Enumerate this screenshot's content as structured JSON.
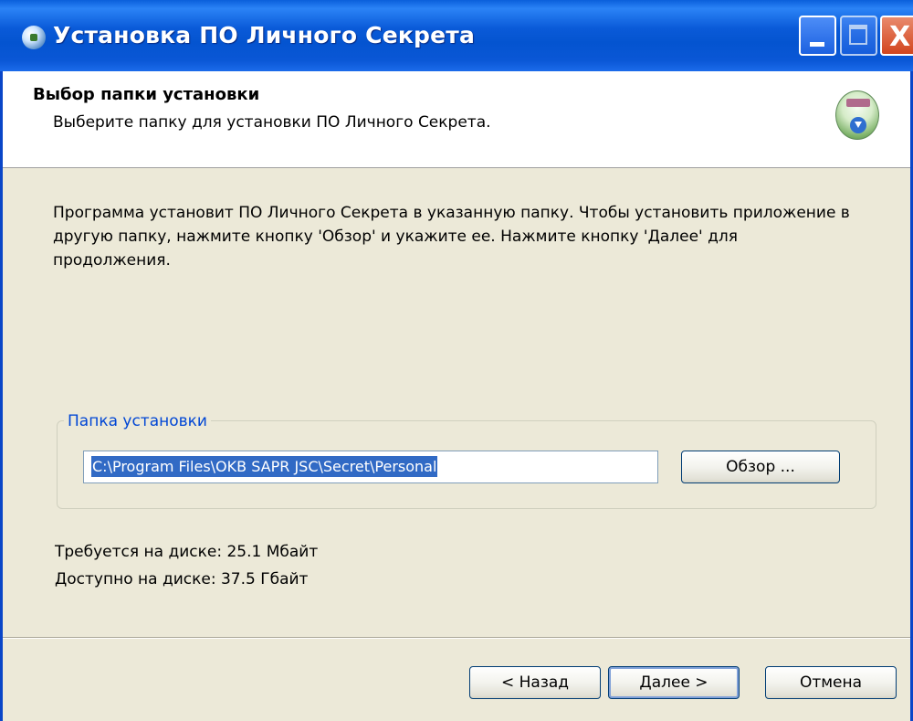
{
  "window": {
    "title": "Установка ПО Личного Секрета",
    "minimize_glyph": "_",
    "close_glyph": "X"
  },
  "header": {
    "title": "Выбор папки установки",
    "subtitle": "Выберите папку для установки ПО Личного Секрета.",
    "logo_icon": "installer-disk-icon"
  },
  "body": {
    "description": "Программа установит ПО Личного Секрета в указанную папку. Чтобы установить приложение в другую папку, нажмите кнопку 'Обзор' и укажите ее. Нажмите кнопку 'Далее' для продолжения.",
    "group_label": "Папка установки",
    "install_path": "C:\\Program Files\\OKB SAPR JSC\\Secret\\Personal",
    "browse_label": "Обзор ...",
    "space_required": "Требуется на диске: 25.1 Мбайт",
    "space_available": "Доступно на диске: 37.5 Гбайт"
  },
  "footer": {
    "back_label": "< Назад",
    "next_label": "Далее >",
    "cancel_label": "Отмена"
  },
  "colors": {
    "titlebar": "#0a5ad8",
    "dialog_bg": "#ece9d8",
    "group_label": "#0046d5",
    "selection": "#316ac5",
    "close_button": "#d2451e"
  }
}
